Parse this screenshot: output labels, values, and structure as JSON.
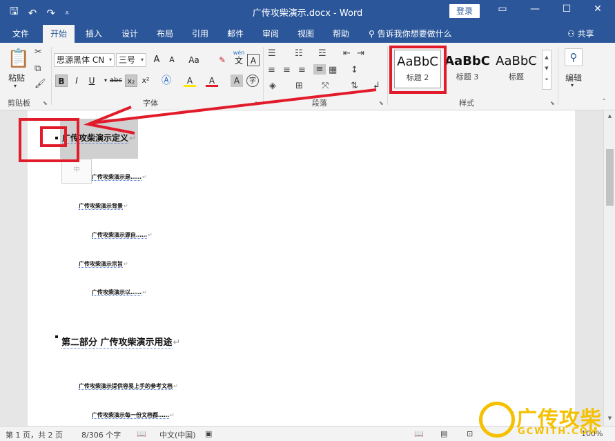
{
  "titlebar": {
    "doc_title": "广传攻柴演示.docx  -  Word",
    "login": "登录",
    "qat_save": "🖫",
    "qat_undo": "↶",
    "qat_redo": "↷",
    "qat_custom": "⩡",
    "ribbon_display": "▭",
    "minimize": "—",
    "maximize": "☐",
    "close": "✕"
  },
  "tabs": [
    "文件",
    "开始",
    "插入",
    "设计",
    "布局",
    "引用",
    "邮件",
    "审阅",
    "视图",
    "帮助"
  ],
  "tellme": "告诉我你想要做什么",
  "share": "共享",
  "ribbon": {
    "clipboard": {
      "paste": "粘贴",
      "label": "剪贴板"
    },
    "font": {
      "name": "思源黑体 CN",
      "size": "三号",
      "grow": "A",
      "shrink": "A",
      "aa": "Aa",
      "bold": "B",
      "italic": "I",
      "underline": "U",
      "strike": "abc",
      "sub": "x₂",
      "sup": "x²",
      "label": "字体",
      "phonetic_top": "wén",
      "phonetic_char": "文",
      "highlight": "A",
      "font_color": "A",
      "char_shade": "A",
      "enclose": "字"
    },
    "paragraph": {
      "label": "段落"
    },
    "styles": {
      "cards": [
        {
          "preview": "AaBbC",
          "name": "标题 2"
        },
        {
          "preview": "AaBbC",
          "name": "标题 3"
        },
        {
          "preview": "AaBbC",
          "name": "标题"
        }
      ],
      "label": "样式"
    },
    "editing": {
      "label": "编辑"
    }
  },
  "document": {
    "heading_title": "广传攻柴演示定义",
    "lines": [
      "广传攻柴演示是……",
      "广传攻柴演示背景",
      "广传攻柴演示源自……",
      "广传攻柴演示宗旨",
      "广传攻柴演示以……"
    ],
    "part2": "第二部分  广传攻柴演示用途",
    "part2_lines": [
      "广传攻柴演示提供容易上手的参考文档",
      "广传攻柴演示每一份文档都……"
    ],
    "return_mark": "↵"
  },
  "statusbar": {
    "page": "第 1 页，共 2 页",
    "words": "8/306 个字",
    "language": "中文(中国)",
    "zoom": "100%"
  },
  "watermark": {
    "text": "广传攻柴",
    "sub": "GCWITH.COM"
  },
  "colors": {
    "accent": "#2b579a",
    "annotation_red": "#e21b2b",
    "watermark": "#f4c000"
  }
}
